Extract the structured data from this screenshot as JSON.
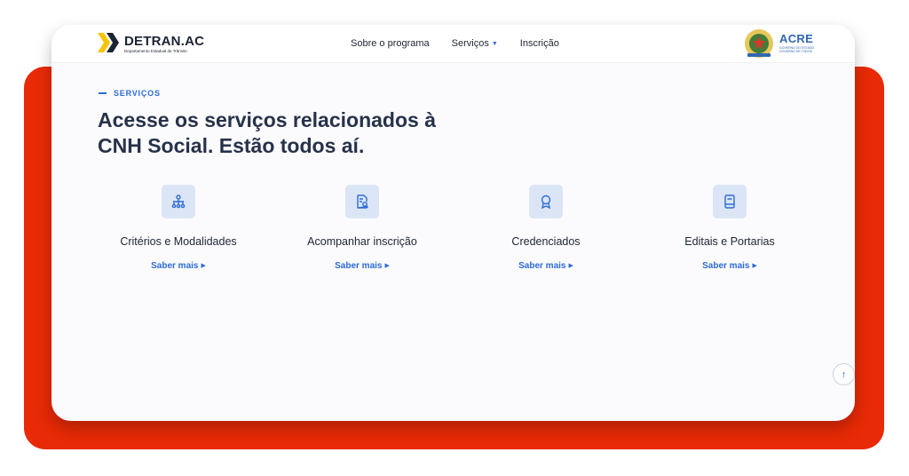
{
  "header": {
    "logo": {
      "name": "DETRAN.AC",
      "subtitle": "Departamento Estadual de Trânsito"
    },
    "nav": [
      {
        "label": "Sobre o programa",
        "has_dropdown": false
      },
      {
        "label": "Serviços",
        "has_dropdown": true
      },
      {
        "label": "Inscrição",
        "has_dropdown": false
      }
    ],
    "gov_logo": {
      "name": "ACRE",
      "tagline": "GOVERNO DO ESTADO GOVERNO DE TODOS"
    }
  },
  "section": {
    "eyebrow": "SERVIÇOS",
    "headline_line1": "Acesse os serviços relacionados à",
    "headline_line2": "CNH Social. Estão todos aí."
  },
  "services": [
    {
      "title": "Critérios e Modalidades",
      "link": "Saber mais",
      "icon": "hierarchy-icon"
    },
    {
      "title": "Acompanhar inscrição",
      "link": "Saber mais",
      "icon": "document-search-icon"
    },
    {
      "title": "Credenciados",
      "link": "Saber mais",
      "icon": "award-badge-icon"
    },
    {
      "title": "Editais e Portarias",
      "link": "Saber mais",
      "icon": "book-icon"
    }
  ],
  "scroll_top": {
    "icon": "arrow-up-icon"
  },
  "colors": {
    "accent": "#2c6bd6",
    "heading": "#27324a",
    "backdrop": "#e82a06",
    "logo_yellow": "#f6c400",
    "icon_bg": "#dbe5f6"
  }
}
